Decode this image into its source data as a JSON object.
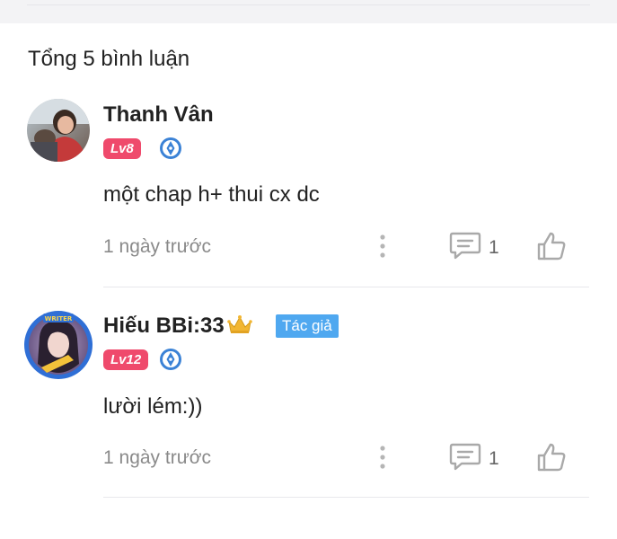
{
  "comments_header": {
    "total": "Tổng 5 bình luận"
  },
  "comments": [
    {
      "author": "Thanh Vân",
      "level": "Lv8",
      "text": "một chap h+ thui cx dc",
      "time": "1 ngày trước",
      "reply_count": "1",
      "is_author": false
    },
    {
      "author": "Hiếu BBi:33",
      "level": "Lv12",
      "author_badge": "Tác giả",
      "avatar_frame_label": "WRITER",
      "text": "lười lém:))",
      "time": "1 ngày trước",
      "reply_count": "1",
      "is_author": true
    }
  ],
  "colors": {
    "level_badge": "#ef4a6c",
    "author_badge": "#4fa8f0",
    "pen_badge": "#3b82d6",
    "muted_text": "#8a8a8a"
  },
  "icons": [
    "pen-badge-icon",
    "more-vertical-icon",
    "comment-icon",
    "thumbs-up-icon",
    "crown-icon"
  ]
}
